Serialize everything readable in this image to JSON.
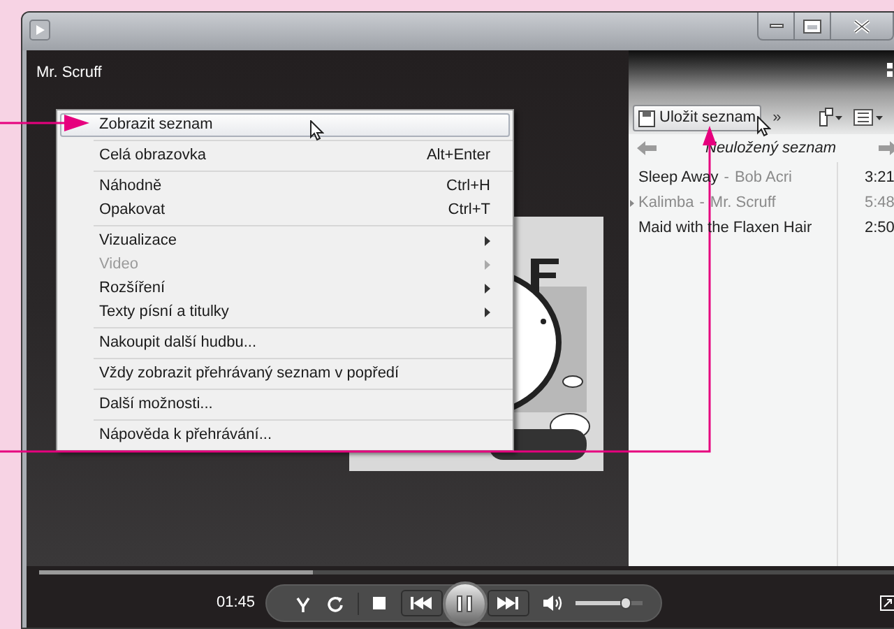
{
  "now_playing": "Mr. Scruff",
  "menu": {
    "groups": [
      [
        {
          "label": "Zobrazit seznam",
          "selected": true,
          "disabled": false
        }
      ],
      [
        {
          "label": "Celá obrazovka",
          "shortcut": "Alt+Enter",
          "selected": false,
          "disabled": false
        }
      ],
      [
        {
          "label": "Náhodně",
          "shortcut": "Ctrl+H",
          "selected": false,
          "disabled": false
        },
        {
          "label": "Opakovat",
          "shortcut": "Ctrl+T",
          "selected": false,
          "disabled": false
        }
      ],
      [
        {
          "label": "Vizualizace",
          "submenu": true,
          "selected": false,
          "disabled": false
        },
        {
          "label": "Video",
          "submenu": true,
          "selected": false,
          "disabled": true
        },
        {
          "label": "Rozšíření",
          "submenu": true,
          "selected": false,
          "disabled": false
        },
        {
          "label": "Texty písní a titulky",
          "submenu": true,
          "selected": false,
          "disabled": false
        }
      ],
      [
        {
          "label": "Nakoupit další hudbu...",
          "selected": false,
          "disabled": false
        }
      ],
      [
        {
          "label": "Vždy zobrazit přehrávaný seznam v popředí",
          "selected": false,
          "disabled": false
        }
      ],
      [
        {
          "label": "Další možnosti...",
          "selected": false,
          "disabled": false
        }
      ],
      [
        {
          "label": "Nápověda k přehrávání...",
          "selected": false,
          "disabled": false
        }
      ]
    ]
  },
  "playlist": {
    "save_button": "Uložit seznam",
    "more": "»",
    "title": "Neuložený seznam",
    "tracks": [
      {
        "title": "Sleep Away",
        "separator": "-",
        "artist": "Bob Acri",
        "duration": "3:21",
        "playing": false
      },
      {
        "title": "Kalimba",
        "separator": "-",
        "artist": "Mr. Scruff",
        "duration": "5:48",
        "playing": true
      },
      {
        "title": "Maid with the Flaxen Hair",
        "duration": "2:50",
        "playing": false
      }
    ]
  },
  "controls": {
    "time": "01:45",
    "seek": {
      "level": 0.32
    },
    "volume": {
      "level": 0.75
    }
  }
}
